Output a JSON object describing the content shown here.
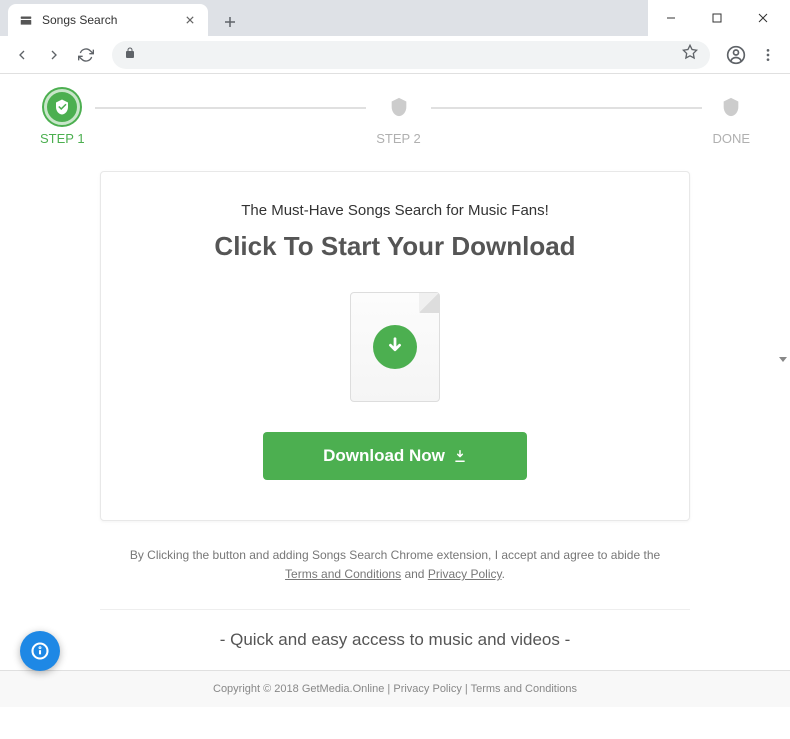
{
  "window": {
    "tab_title": "Songs Search"
  },
  "progress": {
    "step1": "STEP 1",
    "step2": "STEP 2",
    "done": "DONE"
  },
  "card": {
    "subtitle": "The Must-Have Songs Search for Music Fans!",
    "title": "Click To Start Your Download",
    "download_button": "Download Now"
  },
  "disclaimer": {
    "text_before": "By Clicking the button and adding Songs Search Chrome extension, I accept and agree to abide the ",
    "terms": "Terms and Conditions",
    "and": " and ",
    "privacy": "Privacy Policy",
    "period": "."
  },
  "feature": "- Quick and easy access to music and videos -",
  "footer": {
    "copyright": "Copyright © 2018 GetMedia.Online",
    "sep": " | ",
    "privacy": "Privacy Policy",
    "terms": "Terms and Conditions"
  }
}
